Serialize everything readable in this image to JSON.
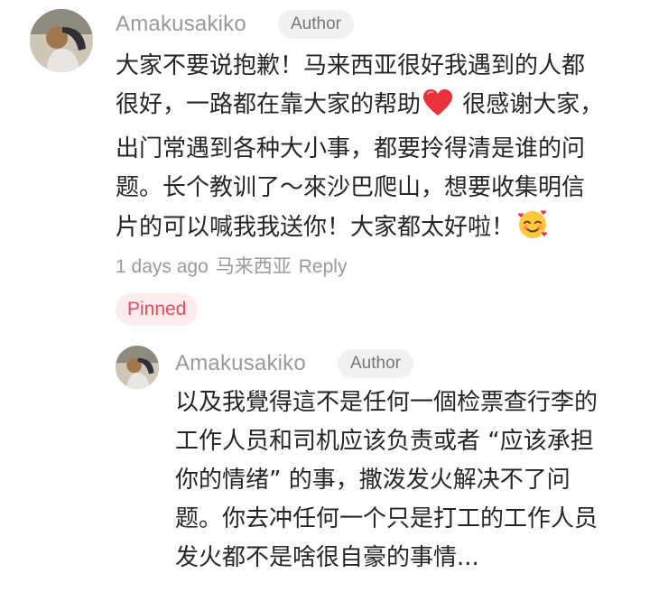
{
  "comments": [
    {
      "author": "Amakusakiko",
      "badge": "Author",
      "lines": [
        "大家不要说抱歉！马来西亚很好我遇到的人都",
        "很好，一路都在靠大家的帮助",
        "很感谢大家，",
        "出门常遇到各种大小事，都要拎得清是谁的问",
        "题。长个教训了～來沙巴爬山，想要收集明信",
        "片的可以喊我我送你！大家都太好啦！"
      ],
      "emojis": [
        "red-heart",
        "smiling-face-with-hearts"
      ],
      "time": "1 days ago",
      "location": "马来西亚",
      "reply_label": "Reply",
      "pinned_label": "Pinned"
    },
    {
      "author": "Amakusakiko",
      "badge": "Author",
      "lines": [
        "以及我覺得這不是任何一個检票查行李的",
        "工作人员和司机应该负责或者 “应该承担",
        "你的情绪” 的事，撒泼发火解决不了问",
        "题。你去冲任何一个只是打工的工作人员",
        "发火都不是啥很自豪的事情..."
      ]
    }
  ],
  "colors": {
    "author_gray": "#9a9a9a",
    "badge_bg": "#f1f1f1",
    "pinned_bg": "#fdecec",
    "pinned_text": "#e84a5f",
    "heart_red": "#e8323c"
  }
}
